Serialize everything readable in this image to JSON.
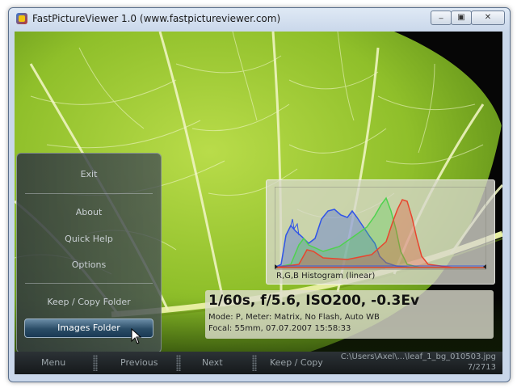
{
  "window": {
    "title": "FastPictureViewer 1.0 (www.fastpictureviewer.com)",
    "controls": {
      "minimize": "_",
      "maximize": "▣",
      "close": "✕"
    }
  },
  "menu": {
    "items": [
      {
        "label": "Exit"
      },
      {
        "label": "About"
      },
      {
        "label": "Quick Help"
      },
      {
        "label": "Options"
      },
      {
        "label": "Keep / Copy Folder"
      },
      {
        "label": "Images Folder",
        "active": true
      }
    ]
  },
  "histogram": {
    "label": "R,G,B Histogram (linear)",
    "colors": {
      "red": "#e8452f",
      "green": "#4fd24f",
      "blue": "#2f54e8"
    }
  },
  "exif": {
    "main": "1/60s, f/5.6, ISO200, -0.3Ev",
    "mode": "Mode: P, Meter: Matrix, No Flash, Auto WB",
    "focal": "Focal: 55mm, 07.07.2007 15:58:33"
  },
  "bottom_bar": {
    "menu": "Menu",
    "previous": "Previous",
    "next": "Next",
    "keep_copy": "Keep / Copy",
    "file_path": "C:\\Users\\Axel\\...\\leaf_1_bg_010503.jpg",
    "file_count": "7/2713"
  },
  "colors": {
    "leaf_green": "#8fbf2a",
    "vein": "#e9f0b0",
    "active_button": "#2a4c66"
  }
}
